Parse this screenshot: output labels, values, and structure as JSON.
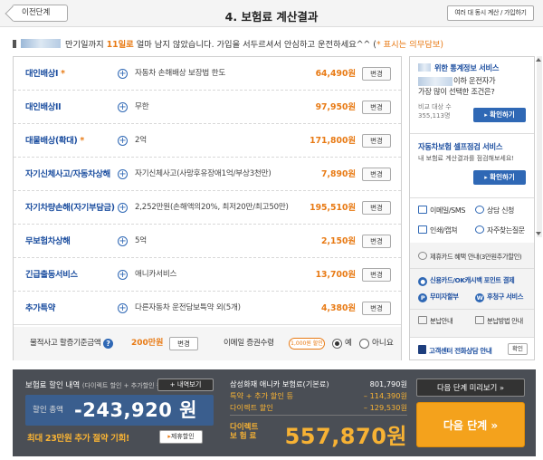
{
  "header": {
    "prev_label": "이전단계",
    "title": "4. 보험료 계산결과",
    "multi_label": "여러 대 동시 계산 / 가입하기"
  },
  "notice": {
    "before": "만기일까지",
    "days": "11일로",
    "after": "얼마 남지 않았습니다. 가입을 서두르셔서 안심하고 운전하세요^^ (",
    "req": "* 표시는 의무담보)"
  },
  "coverages": [
    {
      "label": "대인배상I",
      "required": true,
      "desc": "자동차 손해배상 보장법 한도",
      "price": "64,490원",
      "change": "변경"
    },
    {
      "label": "대인배상II",
      "required": false,
      "desc": "무한",
      "price": "97,950원",
      "change": "변경"
    },
    {
      "label": "대물배상(확대)",
      "required": true,
      "desc": "2억",
      "price": "171,800원",
      "change": "변경"
    },
    {
      "label": "자기신체사고/자동차상해",
      "required": false,
      "desc": "자기신체사고(사망후유장애1억/부상3천만)",
      "price": "7,890원",
      "change": "변경"
    },
    {
      "label": "자기차량손해(자기부담금)",
      "required": false,
      "desc": "2,252만원(손해액의20%, 최저20만/최고50만)",
      "price": "195,510원",
      "change": "변경"
    },
    {
      "label": "무보험차상해",
      "required": false,
      "desc": "5억",
      "price": "2,150원",
      "change": "변경"
    },
    {
      "label": "긴급출동서비스",
      "required": false,
      "desc": "애니카서비스",
      "price": "13,700원",
      "change": "변경"
    },
    {
      "label": "추가특약",
      "required": false,
      "desc": "다른자동차 운전담보특약 외(5개)",
      "price": "4,380원",
      "change": "변경"
    }
  ],
  "bottom": {
    "property_label": "물적사고 할증기준금액",
    "property_value": "200만원",
    "property_change": "변경",
    "email_label": "이메일 증권수령",
    "email_badge": "1,000원 할인",
    "yes": "예",
    "no": "아니요"
  },
  "sidebar": {
    "stats_title": "위한 통계정보 서비스",
    "stats_q1": "이하 운전자가",
    "stats_q2": "가장 많이 선택한 조건은?",
    "stats_sub1": "비교 대상 수",
    "stats_sub2": "355,113명",
    "stats_btn": "확인하기",
    "selfcheck_title": "자동차보험 셀프점검 서비스",
    "selfcheck_txt": "내 보험료 계산결과를 점검해보세요!",
    "selfcheck_btn": "확인하기",
    "email_sms": "이메일/SMS",
    "consult": "상담 신청",
    "print": "인쇄/캡쳐",
    "faq": "자주찾는질문",
    "card_info": "제휴카드 혜택 안내(3만원추가할인)",
    "ok_cashbag": "신용카드/OK캐시백 포인트 결제",
    "no_accident": "무미자할부",
    "later_service": "후청구 서비스",
    "installment_info": "분납안내",
    "installment_method": "분납방법 안내",
    "call_center": "고객센터 전화상담 안내",
    "call_btn": "확인"
  },
  "footer": {
    "title": "보험료 할인 내역",
    "title_sub": "(다이렉트 할인 + 추가할인 등)",
    "detail_btn": "+ 내역보기",
    "discount_label": "할인 총액",
    "discount_value": "-243,920 원",
    "save_text": "최대 23만원 추가 절약 기회!",
    "discount_btn": "제휴할인",
    "product_label": "삼성화재 애니카 보험료(기본료)",
    "product_value": "801,790원",
    "special_label": "특약 + 추가 할인 등",
    "special_value": "– 114,390원",
    "direct_label": "다이렉트 할인",
    "direct_value": "– 129,530원",
    "final_label1": "다이렉트",
    "final_label2": "보 험 료",
    "final_value": "557,870원",
    "preview_btn": "다음 단계 미리보기 »",
    "next_btn": "다음 단계 »"
  }
}
